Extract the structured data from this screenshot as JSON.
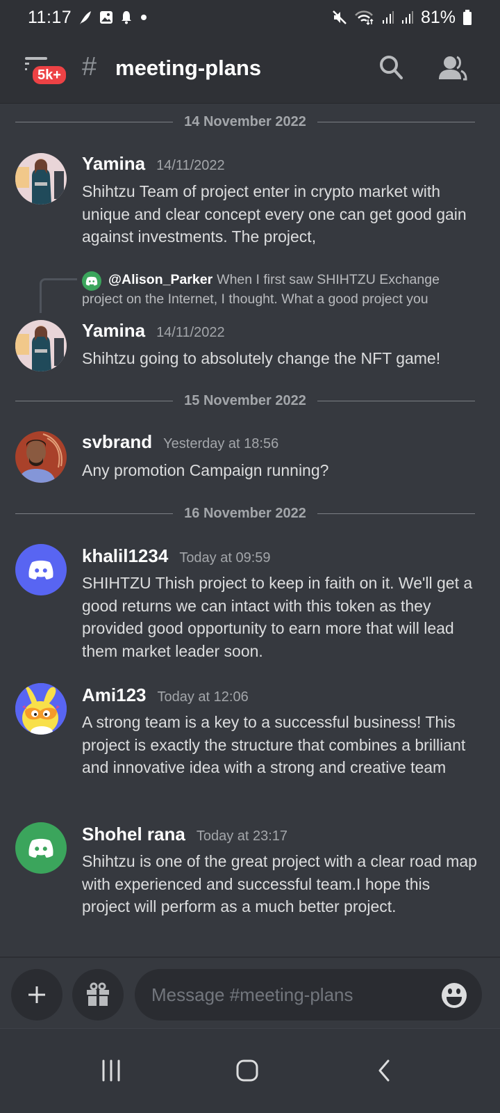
{
  "status_bar": {
    "time": "11:17",
    "left_icons": [
      "feather-icon",
      "image-icon",
      "bell-icon",
      "dot-icon"
    ],
    "right_icons": [
      "mute-icon",
      "wifi-icon",
      "signal-icon",
      "signal-icon"
    ],
    "battery_percent": "81%"
  },
  "header": {
    "unread_badge": "5k+",
    "channel_prefix": "#",
    "channel_name": "meeting-plans",
    "actions": [
      "search-icon",
      "members-icon"
    ]
  },
  "dividers": [
    {
      "label": "14 November 2022"
    },
    {
      "label": "15 November 2022"
    },
    {
      "label": "16 November 2022"
    }
  ],
  "messages": [
    {
      "username": "Yamina",
      "timestamp": "14/11/2022",
      "body": "Shihtzu Team of project enter in crypto market with unique and clear concept every one can get good gain against investments. The project,",
      "avatar": "photo"
    },
    {
      "reply": {
        "mention": "@Alison_Parker",
        "text": "When I first saw SHIHTZU Exchange project on the Internet, I thought. What a good project you",
        "avatar_color": "#3ba55c"
      },
      "username": "Yamina",
      "timestamp": "14/11/2022",
      "body": "Shihtzu  going to absolutely change the NFT game!",
      "avatar": "photo"
    },
    {
      "username": "svbrand",
      "timestamp": "Yesterday at 18:56",
      "body": "Any promotion Campaign running?",
      "avatar": "photo"
    },
    {
      "username": "khalil1234",
      "timestamp": "Today at 09:59",
      "body": "SHIHTZU Thish project to keep in faith on it. We'll get a good returns we can intact with this token as they provided good opportunity to earn more that will lead them market leader soon.",
      "avatar": "discord-default",
      "avatar_color": "#5865f2"
    },
    {
      "username": "Ami123",
      "timestamp": "Today at 12:06",
      "body": "A strong team is a key to a successful business! This project is exactly the structure that combines a brilliant and innovative idea with a strong and creative team",
      "avatar": "cartoon-bunny"
    },
    {
      "username": "Shohel rana",
      "timestamp": "Today at 23:17",
      "body": "Shihtzu is one of the great project with a clear road map with experienced and successful team.I hope this project will perform as a much better project.",
      "avatar": "discord-default",
      "avatar_color": "#3ba55c"
    }
  ],
  "composer": {
    "input_value": "",
    "placeholder": "Message #meeting-plans",
    "buttons": [
      "add-icon",
      "gift-icon",
      "emoji-icon"
    ]
  },
  "nav_bar": {
    "buttons": [
      "recents-icon",
      "home-icon",
      "back-icon"
    ]
  },
  "colors": {
    "background": "#36393f",
    "header": "#2f3136",
    "badge": "#ed4245",
    "blurple": "#5865f2",
    "green": "#3ba55c"
  }
}
